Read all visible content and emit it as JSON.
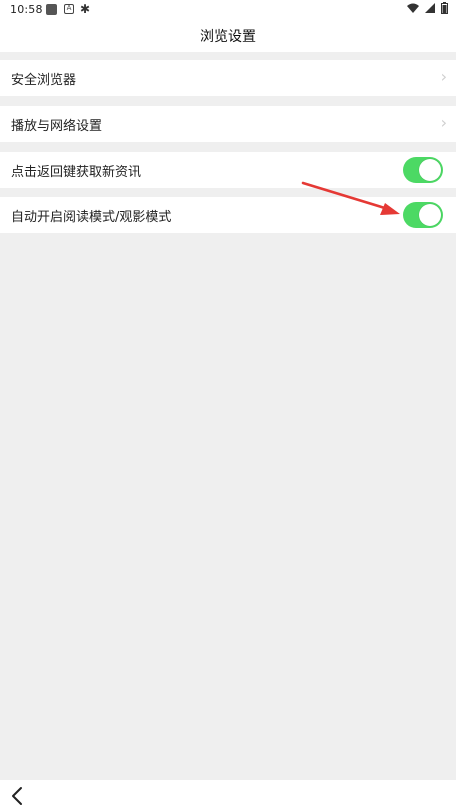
{
  "status_bar": {
    "time": "10:58",
    "icons": [
      "app-icon",
      "a-icon",
      "bug-icon",
      "wifi-icon",
      "signal-icon",
      "battery-icon"
    ]
  },
  "header": {
    "title": "浏览设置"
  },
  "settings": [
    {
      "label": "安全浏览器",
      "control": "chevron"
    },
    {
      "label": "播放与网络设置",
      "control": "chevron"
    },
    {
      "label": "点击返回键获取新资讯",
      "control": "toggle",
      "state": "on"
    },
    {
      "label": "自动开启阅读模式/观影模式",
      "control": "toggle",
      "state": "on"
    }
  ],
  "colors": {
    "toggle_on": "#4cd964",
    "arrow": "#e53935"
  }
}
